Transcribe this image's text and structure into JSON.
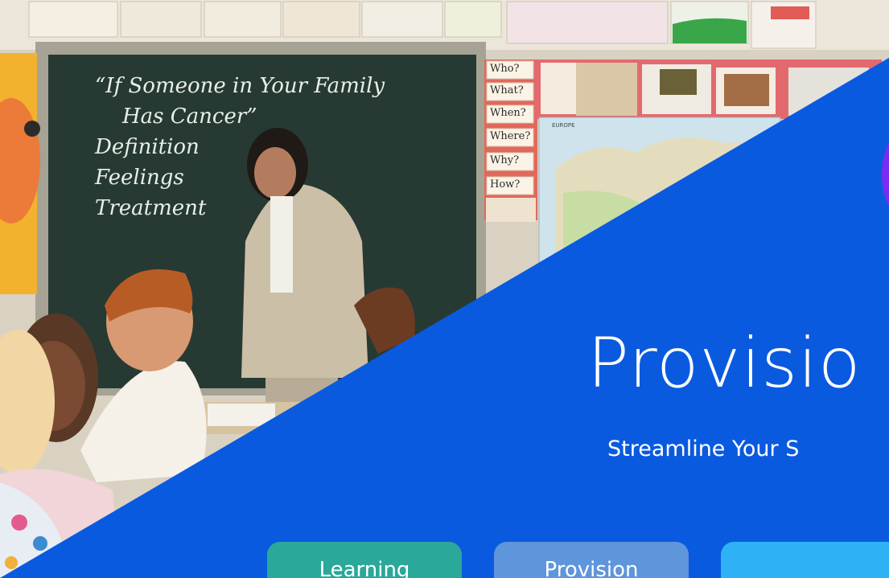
{
  "hero": {
    "title": "Provisio",
    "subtitle": "Streamline Your S",
    "background_image": "classroom-photo",
    "colors": {
      "overlay": "#0a5ae0",
      "accent_blob": "#7a2cf0",
      "button_learning": "#2aa89a",
      "button_provision": "#5f95db",
      "button_third": "#2fb2f5"
    }
  },
  "chalkboard": {
    "lines": [
      "“If Someone in Your Family",
      "Has Cancer”",
      "Definition",
      "Feelings",
      "Treatment"
    ]
  },
  "question_cards": [
    "Who?",
    "What?",
    "When?",
    "Where?",
    "Why?",
    "How?"
  ],
  "map_label": "EUROPE",
  "buttons": [
    {
      "label": "Learning"
    },
    {
      "label": "Provision"
    },
    {
      "label": ""
    }
  ]
}
